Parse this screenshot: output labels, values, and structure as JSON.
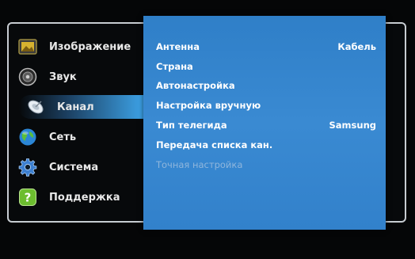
{
  "sidebar": {
    "items": [
      {
        "label": "Изображение",
        "icon": "picture-icon"
      },
      {
        "label": "Звук",
        "icon": "speaker-icon"
      },
      {
        "label": "Канал",
        "icon": "satellite-dish-icon"
      },
      {
        "label": "Сеть",
        "icon": "globe-icon"
      },
      {
        "label": "Система",
        "icon": "gear-icon"
      },
      {
        "label": "Поддержка",
        "icon": "help-icon"
      }
    ],
    "active_index": 2
  },
  "channel_menu": {
    "items": [
      {
        "label": "Антенна",
        "value": "Кабель"
      },
      {
        "label": "Страна",
        "value": ""
      },
      {
        "label": "Автонастройка",
        "value": ""
      },
      {
        "label": "Настройка вручную",
        "value": ""
      },
      {
        "label": "Тип телегида",
        "value": "Samsung"
      },
      {
        "label": "Передача списка кан.",
        "value": ""
      },
      {
        "label": "Точная настройка",
        "value": "",
        "disabled": true
      }
    ]
  },
  "colors": {
    "panel": "#3a8ad2",
    "highlight": "#3fa9f0",
    "disabled_text": "#8fb6dc"
  }
}
